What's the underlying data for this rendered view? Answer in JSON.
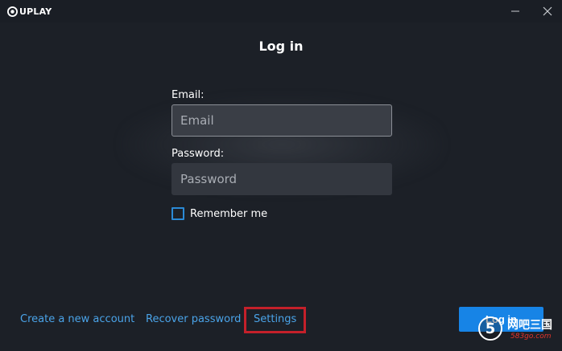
{
  "app": {
    "brand": "UPLAY",
    "icons": {
      "logo": "uplay-logo-icon",
      "minimize": "minimize-icon",
      "close": "close-icon"
    }
  },
  "login": {
    "title": "Log in",
    "email_label": "Email:",
    "email_placeholder": "Email",
    "email_value": "",
    "password_label": "Password:",
    "password_placeholder": "Password",
    "password_value": "",
    "remember_label": "Remember me",
    "remember_checked": false,
    "submit_label": "Log in"
  },
  "footer": {
    "create_account": "Create a new account",
    "recover_password": "Recover password",
    "settings": "Settings"
  },
  "watermark": {
    "glyph": "5",
    "text": "网吧三国",
    "domain": "583go.com"
  },
  "colors": {
    "background": "#1c2027",
    "accent": "#1784e6",
    "link": "#4aa3e8",
    "highlight": "#c4202a",
    "field": "#33373f"
  }
}
